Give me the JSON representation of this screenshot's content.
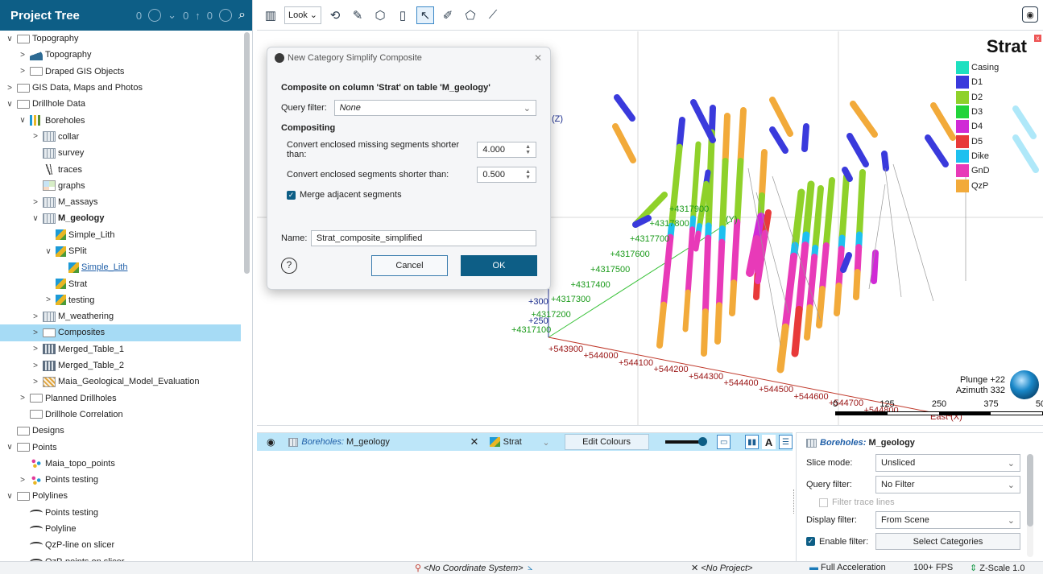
{
  "tree": {
    "title": "Project Tree",
    "header_icons": {
      "left_count": "0",
      "mid_count": "0",
      "right_count": "0"
    },
    "items": [
      {
        "label": "Topography",
        "level": 0,
        "chevron": "∨",
        "icon": "folder"
      },
      {
        "label": "Topography",
        "level": 1,
        "chevron": ">",
        "icon": "topo"
      },
      {
        "label": "Draped GIS Objects",
        "level": 1,
        "chevron": ">",
        "icon": "folder"
      },
      {
        "label": "GIS Data, Maps and Photos",
        "level": 0,
        "chevron": ">",
        "icon": "folder"
      },
      {
        "label": "Drillhole Data",
        "level": 0,
        "chevron": "∨",
        "icon": "folder"
      },
      {
        "label": "Boreholes",
        "level": 1,
        "chevron": "∨",
        "icon": "bore"
      },
      {
        "label": "collar",
        "level": 2,
        "chevron": ">",
        "icon": "table"
      },
      {
        "label": "survey",
        "level": 2,
        "chevron": "",
        "icon": "table"
      },
      {
        "label": "traces",
        "level": 2,
        "chevron": "",
        "icon": "traces"
      },
      {
        "label": "graphs",
        "level": 2,
        "chevron": "",
        "icon": "graph"
      },
      {
        "label": "M_assays",
        "level": 2,
        "chevron": ">",
        "icon": "table"
      },
      {
        "label": "M_geology",
        "level": 2,
        "chevron": "∨",
        "icon": "table",
        "bold": true
      },
      {
        "label": "Simple_Lith",
        "level": 3,
        "chevron": "",
        "icon": "cat"
      },
      {
        "label": "SPlit",
        "level": 3,
        "chevron": "∨",
        "icon": "cat"
      },
      {
        "label": "Simple_Lith",
        "level": 4,
        "chevron": "",
        "icon": "cat",
        "link": true
      },
      {
        "label": "Strat",
        "level": 3,
        "chevron": "",
        "icon": "cat"
      },
      {
        "label": "testing",
        "level": 3,
        "chevron": ">",
        "icon": "cat"
      },
      {
        "label": "M_weathering",
        "level": 2,
        "chevron": ">",
        "icon": "table"
      },
      {
        "label": "Composites",
        "level": 2,
        "chevron": ">",
        "icon": "folder",
        "selected": true
      },
      {
        "label": "Merged_Table_1",
        "level": 2,
        "chevron": ">",
        "icon": "merge"
      },
      {
        "label": "Merged_Table_2",
        "level": 2,
        "chevron": ">",
        "icon": "merge"
      },
      {
        "label": "Maia_Geological_Model_Evaluation",
        "level": 2,
        "chevron": ">",
        "icon": "eval"
      },
      {
        "label": "Planned Drillholes",
        "level": 1,
        "chevron": ">",
        "icon": "folder"
      },
      {
        "label": "Drillhole Correlation",
        "level": 1,
        "chevron": "",
        "icon": "folder"
      },
      {
        "label": "Designs",
        "level": 0,
        "chevron": "",
        "icon": "folder"
      },
      {
        "label": "Points",
        "level": 0,
        "chevron": "∨",
        "icon": "folder"
      },
      {
        "label": "Maia_topo_points",
        "level": 1,
        "chevron": "",
        "icon": "pts"
      },
      {
        "label": "Points testing",
        "level": 1,
        "chevron": ">",
        "icon": "pts"
      },
      {
        "label": "Polylines",
        "level": 0,
        "chevron": "∨",
        "icon": "folder"
      },
      {
        "label": "Points testing",
        "level": 1,
        "chevron": "",
        "icon": "line"
      },
      {
        "label": "Polyline",
        "level": 1,
        "chevron": "",
        "icon": "line"
      },
      {
        "label": "QzP-line on slicer",
        "level": 1,
        "chevron": "",
        "icon": "line"
      },
      {
        "label": "QzP-points on slicer",
        "level": 1,
        "chevron": "",
        "icon": "line"
      }
    ]
  },
  "toolbar": {
    "mode_select": "Look",
    "icons": [
      "rotate-icon",
      "pen-icon",
      "shape-icon",
      "panel-icon",
      "select-icon",
      "draw-icon",
      "polygon-icon",
      "ruler-icon"
    ],
    "camera_icon": "camera-icon"
  },
  "dialog": {
    "title": "New Category Simplify Composite",
    "heading": "Composite on column 'Strat' on table 'M_geology'",
    "query_filter_label": "Query filter:",
    "query_filter_value": "None",
    "compositing_heading": "Compositing",
    "missing_label": "Convert enclosed missing segments shorter than:",
    "missing_value": "4.000",
    "segments_label": "Convert enclosed segments shorter than:",
    "segments_value": "0.500",
    "merge_label": "Merge adjacent segments",
    "merge_checked": true,
    "name_label": "Name:",
    "name_value": "Strat_composite_simplified",
    "help_label": "?",
    "cancel_label": "Cancel",
    "ok_label": "OK"
  },
  "scene": {
    "z_label": "(Z)",
    "y_label": "(Y)",
    "north_ticks": [
      "+4317100",
      "+4317200",
      "+4317300",
      "+4317400",
      "+4317500",
      "+4317600",
      "+4317700",
      "+4317800",
      "+4317900"
    ],
    "east_ticks": [
      "+543900",
      "+544000",
      "+544100",
      "+544200",
      "+544300",
      "+544400",
      "+544500",
      "+544600",
      "+544700",
      "+544800"
    ],
    "z_ticks": [
      "+300",
      "+250"
    ],
    "east_axis_label": "East (X)",
    "plunge": "Plunge +22",
    "azimuth": "Azimuth 332",
    "scale_ticks": [
      "0",
      "125",
      "250",
      "375",
      "500"
    ],
    "legend": {
      "title": "Strat",
      "items": [
        {
          "name": "Casing",
          "color": "#1de0c0"
        },
        {
          "name": "D1",
          "color": "#3a3adc"
        },
        {
          "name": "D2",
          "color": "#8fd12a"
        },
        {
          "name": "D3",
          "color": "#22d43a"
        },
        {
          "name": "D4",
          "color": "#d02ad6"
        },
        {
          "name": "D5",
          "color": "#e83a3a"
        },
        {
          "name": "Dike",
          "color": "#1ec0ef"
        },
        {
          "name": "GnD",
          "color": "#e83ab8"
        },
        {
          "name": "QzP",
          "color": "#f2aa3a"
        }
      ]
    }
  },
  "bottom_table": {
    "table_prefix": "Boreholes:",
    "table_name": "M_geology",
    "column": "Strat",
    "edit_colours": "Edit Colours",
    "text_toggle": "A"
  },
  "props": {
    "title_prefix": "Boreholes:",
    "title_name": "M_geology",
    "slice_mode_label": "Slice mode:",
    "slice_mode_value": "Unsliced",
    "query_filter_label": "Query filter:",
    "query_filter_value": "No Filter",
    "filter_trace_label": "Filter trace lines",
    "display_filter_label": "Display filter:",
    "display_filter_value": "From Scene",
    "enable_filter_label": "Enable filter:",
    "select_categories": "Select Categories"
  },
  "status": {
    "coord_system": "<No Coordinate System>",
    "project": "<No Project>",
    "acceleration": "Full Acceleration",
    "fps": "100+ FPS",
    "zscale": "Z-Scale 1.0"
  }
}
